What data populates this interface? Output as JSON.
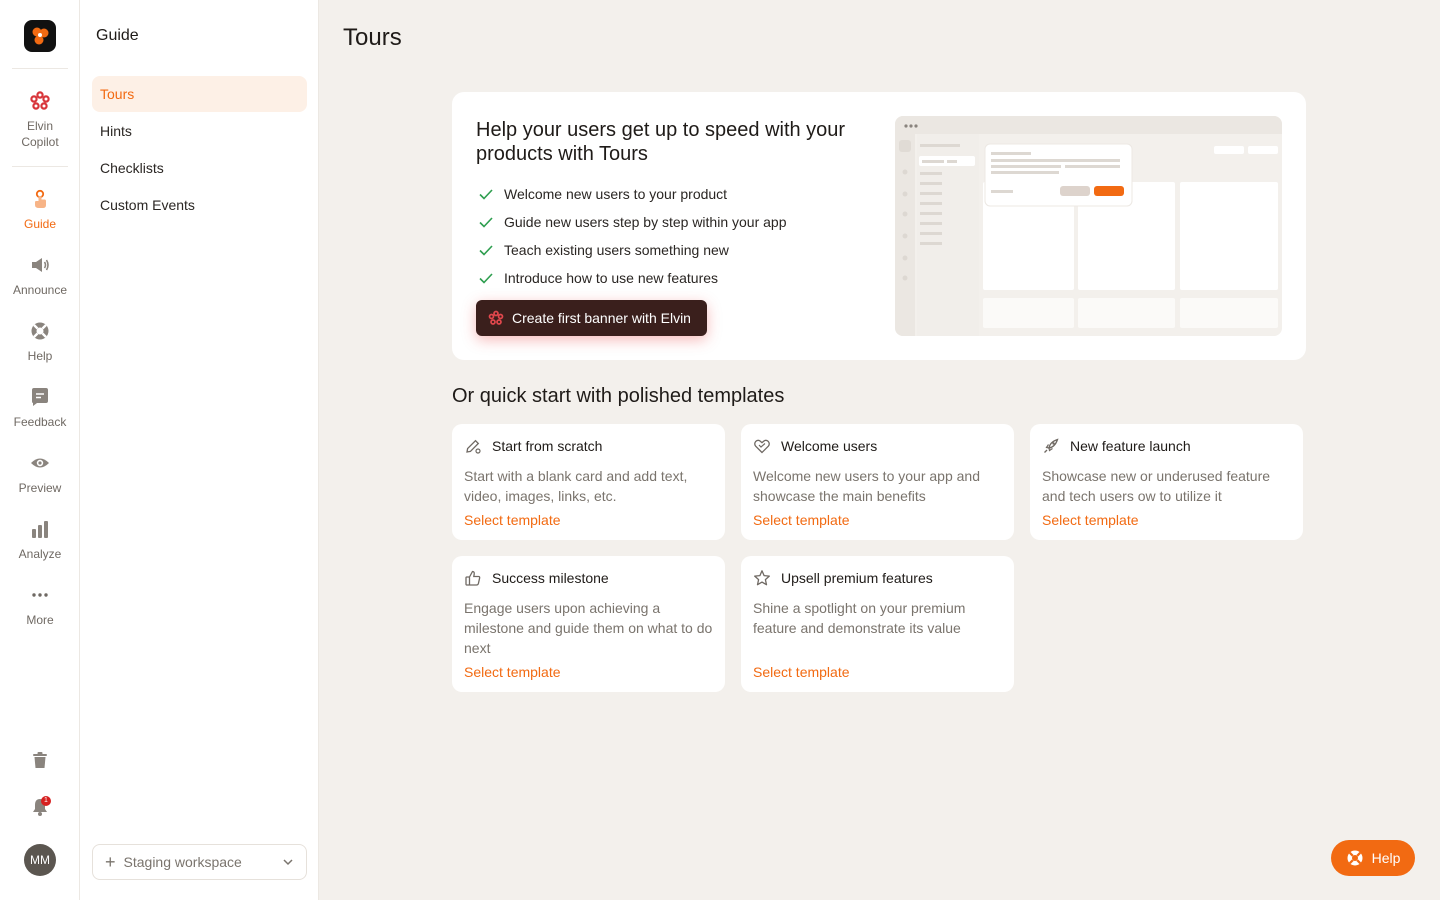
{
  "rail": {
    "items": [
      {
        "label_1": "Elvin",
        "label_2": "Copilot",
        "icon": "elvin-copilot-icon"
      },
      {
        "label": "Guide",
        "icon": "guide-icon",
        "active": true
      },
      {
        "label": "Announce",
        "icon": "megaphone-icon"
      },
      {
        "label": "Help",
        "icon": "lifebuoy-icon"
      },
      {
        "label": "Feedback",
        "icon": "feedback-icon"
      },
      {
        "label": "Preview",
        "icon": "eye-icon"
      },
      {
        "label": "Analyze",
        "icon": "bar-chart-icon"
      },
      {
        "label": "More",
        "icon": "more-dots-icon"
      }
    ],
    "notification_count": "1",
    "avatar_initials": "MM"
  },
  "sidebar": {
    "title": "Guide",
    "items": [
      {
        "label": "Tours",
        "active": true
      },
      {
        "label": "Hints"
      },
      {
        "label": "Checklists"
      },
      {
        "label": "Custom Events"
      }
    ],
    "workspace_label": "Staging workspace"
  },
  "page": {
    "title": "Tours"
  },
  "hero": {
    "title": "Help your users get up to speed with your products with Tours",
    "checklist": [
      "Welcome new users to your product",
      "Guide new users step by step within your app",
      "Teach existing users something new",
      "Introduce how to use new features"
    ],
    "cta_label": "Create first banner with Elvin"
  },
  "templates": {
    "heading": "Or quick start with polished templates",
    "link_label": "Select template",
    "cards": [
      {
        "title": "Start from scratch",
        "description": "Start with a blank card and add text, video, images, links, etc.",
        "icon": "pencil-gear-icon"
      },
      {
        "title": "Welcome users",
        "description": "Welcome new users to your app and showcase the main benefits",
        "icon": "heart-handshake-icon"
      },
      {
        "title": "New feature launch",
        "description": "Showcase new or underused feature and tech users ow to utilize it",
        "icon": "rocket-icon"
      },
      {
        "title": "Success milestone",
        "description": "Engage users upon achieving a milestone and guide them on what to do next",
        "icon": "thumbs-up-icon"
      },
      {
        "title": "Upsell premium features",
        "description": "Shine a spotlight on your premium feature and demonstrate its value",
        "icon": "star-icon"
      }
    ]
  },
  "help_button": {
    "label": "Help"
  },
  "colors": {
    "accent": "#f26a12",
    "background": "#f3f0ec",
    "cta_bg": "#3a1f1c",
    "check_green": "#2e9e4f"
  }
}
